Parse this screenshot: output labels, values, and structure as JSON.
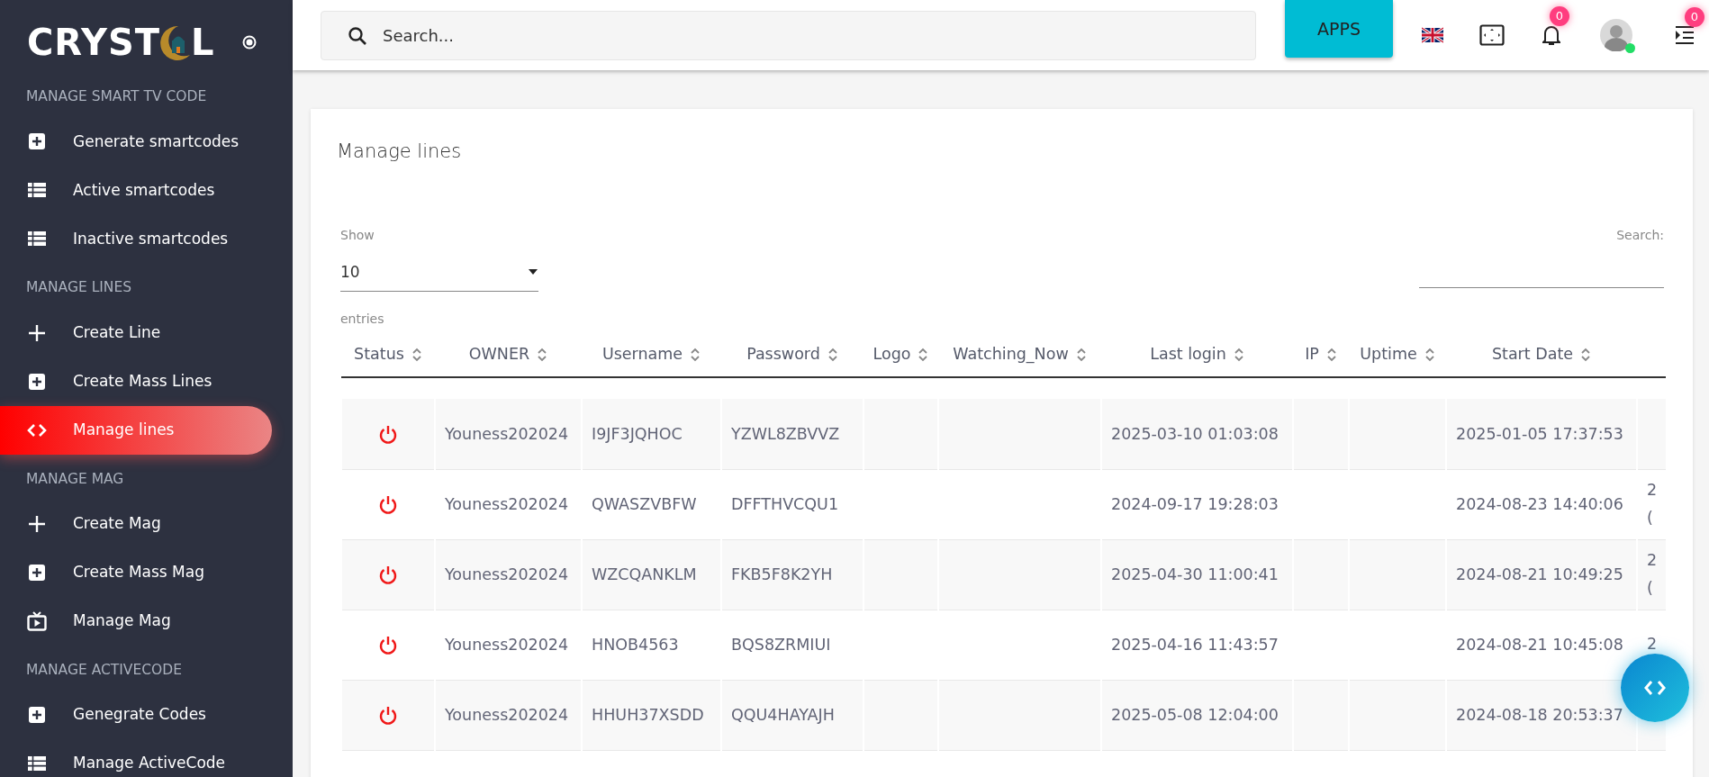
{
  "logo": {
    "text_before": "CRYST",
    "text_after": "L"
  },
  "sidebar": {
    "sections": [
      {
        "title": "MANAGE SMART TV CODE",
        "items": [
          {
            "label": "Generate smartcodes",
            "selected": false
          },
          {
            "label": "Active smartcodes",
            "selected": false
          },
          {
            "label": "Inactive smartcodes",
            "selected": false
          }
        ]
      },
      {
        "title": "MANAGE LINES",
        "items": [
          {
            "label": "Create Line",
            "selected": false
          },
          {
            "label": "Create Mass Lines",
            "selected": false
          },
          {
            "label": "Manage lines",
            "selected": true
          }
        ]
      },
      {
        "title": "MANAGE MAG",
        "items": [
          {
            "label": "Create Mag",
            "selected": false
          },
          {
            "label": "Create Mass Mag",
            "selected": false
          },
          {
            "label": "Manage Mag",
            "selected": false
          }
        ]
      },
      {
        "title": "MANAGE ACTIVECODE",
        "items": [
          {
            "label": "Genegrate Codes",
            "selected": false
          },
          {
            "label": "Manage ActiveCode",
            "selected": false
          }
        ]
      }
    ]
  },
  "topbar": {
    "search": {
      "placeholder": "Search..."
    },
    "apps_button": "APPS",
    "notifications_badge": "0",
    "user": {
      "online": true
    },
    "menu_badge": "0"
  },
  "card": {
    "title": "Manage lines",
    "show_label": "Show",
    "page_size": "10",
    "entries_label": "entries",
    "search_label": "Search:"
  },
  "table": {
    "columns": [
      "Status",
      "OWNER",
      "Username",
      "Password",
      "Logo",
      "Watching_Now",
      "Last login",
      "IP",
      "Uptime",
      "Start Date"
    ],
    "rows": [
      {
        "owner": "Youness202024",
        "username": "I9JF3JQHOC",
        "password": "YZWL8ZBVVZ",
        "last_login": "2025-03-10 01:03:08",
        "start_date": "2025-01-05 17:37:53",
        "column_11": []
      },
      {
        "owner": "Youness202024",
        "username": "QWASZVBFW",
        "password": "DFFTHVCQU1",
        "last_login": "2024-09-17 19:28:03",
        "start_date": "2024-08-23 14:40:06",
        "column_11": [
          "2",
          "("
        ]
      },
      {
        "owner": "Youness202024",
        "username": "WZCQANKLM",
        "password": "FKB5F8K2YH",
        "last_login": "2025-04-30 11:00:41",
        "start_date": "2024-08-21 10:49:25",
        "column_11": [
          "2",
          "("
        ]
      },
      {
        "owner": "Youness202024",
        "username": "HNOB4563",
        "password": "BQS8ZRMIUI",
        "last_login": "2025-04-16 11:43:57",
        "start_date": "2024-08-21 10:45:08",
        "column_11": [
          "2"
        ]
      },
      {
        "owner": "Youness202024",
        "username": "HHUH37XSDD",
        "password": "QQU4HAYAJH",
        "last_login": "2025-05-08 12:04:00",
        "start_date": "2024-08-18 20:53:37",
        "column_11": []
      }
    ]
  }
}
